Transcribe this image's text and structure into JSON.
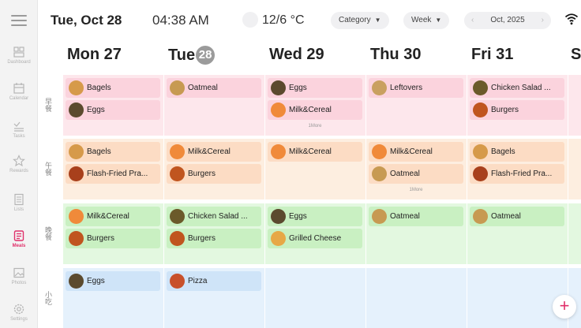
{
  "header": {
    "date": "Tue, Oct 28",
    "time": "04:38 AM",
    "temperature": "12/6 °C",
    "category_label": "Category",
    "view_label": "Week",
    "month_label": "Oct, 2025"
  },
  "sidebar": {
    "items": [
      {
        "label": "Dashboard",
        "icon": "dashboard-icon"
      },
      {
        "label": "Calendar",
        "icon": "calendar-icon"
      },
      {
        "label": "Tasks",
        "icon": "tasks-icon"
      },
      {
        "label": "Rewards",
        "icon": "rewards-icon"
      },
      {
        "label": "Lists",
        "icon": "lists-icon"
      },
      {
        "label": "Meals",
        "icon": "meals-icon",
        "active": true
      },
      {
        "label": "Photos",
        "icon": "photos-icon"
      },
      {
        "label": "Settings",
        "icon": "settings-icon"
      }
    ]
  },
  "days": [
    {
      "name": "Mon",
      "num": "27"
    },
    {
      "name": "Tue",
      "num": "28",
      "today": true
    },
    {
      "name": "Wed",
      "num": "29"
    },
    {
      "name": "Thu",
      "num": "30"
    },
    {
      "name": "Fri",
      "num": "31"
    },
    {
      "name": "S",
      "num": ""
    }
  ],
  "meal_types": [
    {
      "label": "早餐",
      "color": "#fde7ec"
    },
    {
      "label": "午餐",
      "color": "#fdeee0"
    },
    {
      "label": "晚餐",
      "color": "#e3f8e0"
    },
    {
      "label": "小吃",
      "color": "#e5f1fc"
    }
  ],
  "meals": {
    "breakfast": {
      "mon": [
        "Bagels",
        "Eggs"
      ],
      "tue": [
        "Oatmeal"
      ],
      "wed": [
        "Eggs",
        "Milk&Cereal"
      ],
      "wed_more": "1More",
      "thu": [
        "Leftovers"
      ],
      "fri": [
        "Chicken Salad ...",
        "Burgers"
      ]
    },
    "lunch": {
      "mon": [
        "Bagels",
        "Flash-Fried Pra..."
      ],
      "tue": [
        "Milk&Cereal",
        "Burgers"
      ],
      "wed": [
        "Milk&Cereal"
      ],
      "thu": [
        "Milk&Cereal",
        "Oatmeal"
      ],
      "thu_more": "1More",
      "fri": [
        "Bagels",
        "Flash-Fried Pra..."
      ]
    },
    "dinner": {
      "mon": [
        "Milk&Cereal",
        "Burgers"
      ],
      "tue": [
        "Chicken Salad ...",
        "Burgers"
      ],
      "wed": [
        "Eggs",
        "Grilled Cheese"
      ],
      "thu": [
        "Oatmeal"
      ],
      "fri": [
        "Oatmeal"
      ]
    },
    "snack": {
      "mon": [
        "Eggs"
      ],
      "tue": [
        "Pizza"
      ]
    }
  },
  "colors": {
    "accent": "#e0306a",
    "breakfast": "#fde7ec",
    "lunch": "#fdeee0",
    "dinner": "#e3f8e0",
    "snack": "#e5f1fc"
  },
  "fab_label": "+"
}
